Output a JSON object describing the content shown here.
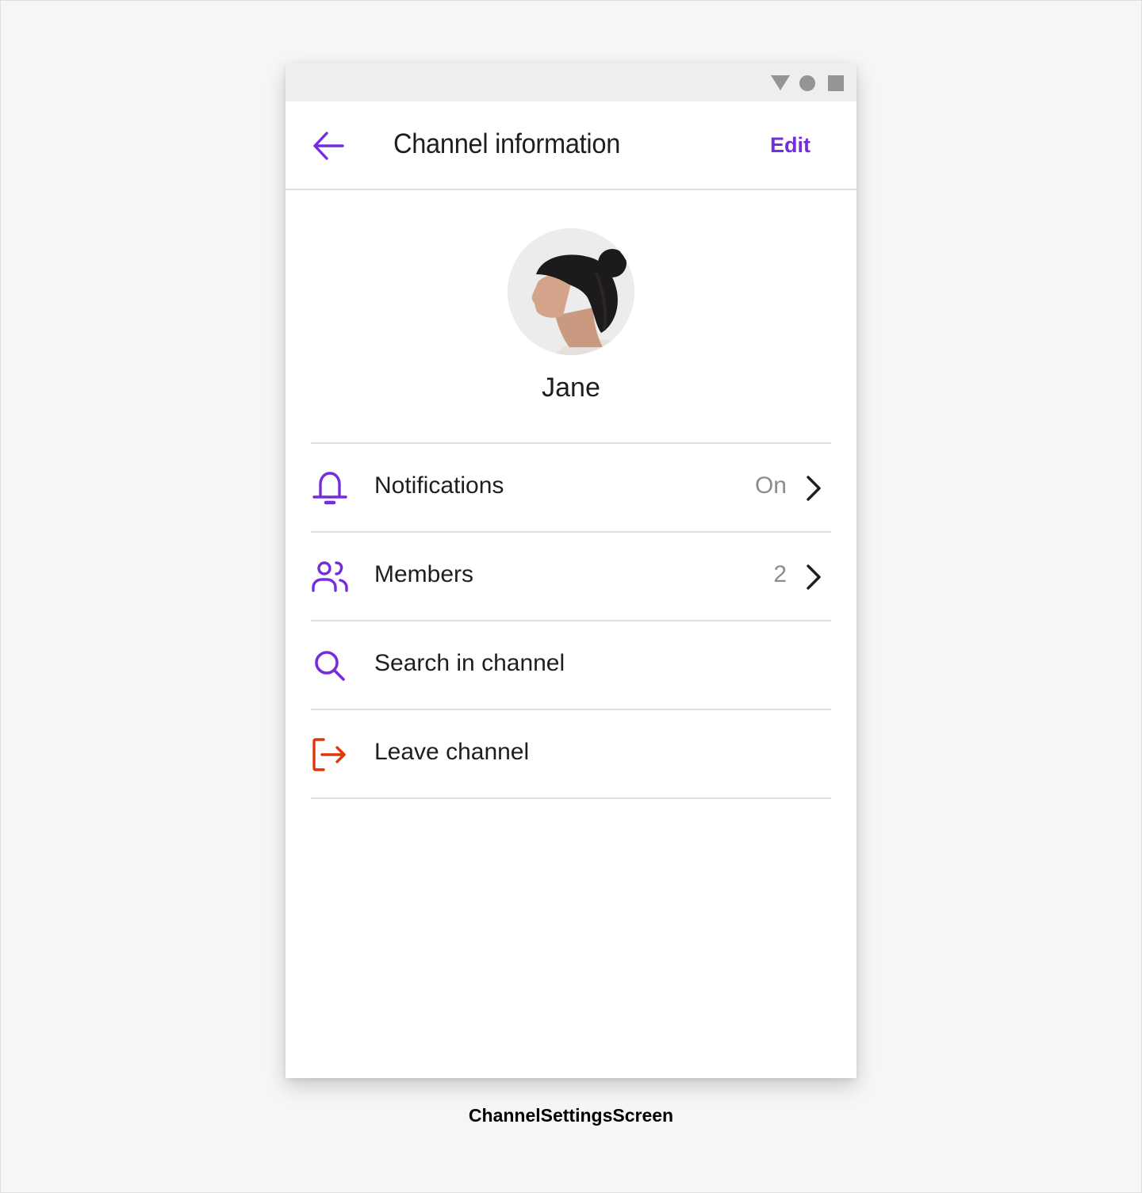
{
  "status_bar": {
    "icons": [
      "signal-triangle-icon",
      "battery-circle-icon",
      "recents-square-icon"
    ]
  },
  "header": {
    "back_icon": "arrow-left-icon",
    "title": "Channel information",
    "edit_label": "Edit"
  },
  "profile": {
    "avatar": "profile-photo",
    "name": "Jane"
  },
  "menu": {
    "items": [
      {
        "icon": "bell-icon",
        "label": "Notifications",
        "value": "On",
        "has_chevron": true
      },
      {
        "icon": "members-icon",
        "label": "Members",
        "value": "2",
        "has_chevron": true
      },
      {
        "icon": "search-icon",
        "label": "Search in channel"
      },
      {
        "icon": "leave-icon",
        "label": "Leave channel"
      }
    ]
  },
  "caption": "ChannelSettingsScreen",
  "colors": {
    "accent": "#742ddd",
    "danger": "#de360b",
    "text": "#1e1e1e",
    "secondary_text": "#8c8c8c",
    "divider": "#e0e0e0"
  }
}
